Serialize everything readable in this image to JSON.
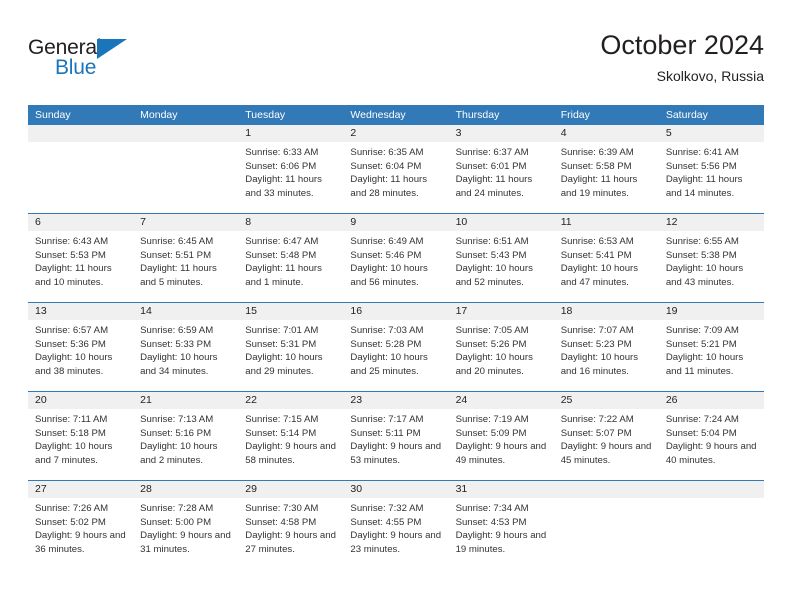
{
  "logo": {
    "word_top": "General",
    "word_bottom": "Blue",
    "accent_color": "#1b75bb"
  },
  "header": {
    "title": "October 2024",
    "subtitle": "Skolkovo, Russia"
  },
  "theme": {
    "header_bg": "#3179b7",
    "datebar_bg": "#f0f0f0",
    "divider": "#3179b7",
    "text": "#222222"
  },
  "weekdays": [
    "Sunday",
    "Monday",
    "Tuesday",
    "Wednesday",
    "Thursday",
    "Friday",
    "Saturday"
  ],
  "weeks": [
    [
      {
        "day": "",
        "sunrise": "",
        "sunset": "",
        "daylight": ""
      },
      {
        "day": "",
        "sunrise": "",
        "sunset": "",
        "daylight": ""
      },
      {
        "day": "1",
        "sunrise": "Sunrise: 6:33 AM",
        "sunset": "Sunset: 6:06 PM",
        "daylight": "Daylight: 11 hours and 33 minutes."
      },
      {
        "day": "2",
        "sunrise": "Sunrise: 6:35 AM",
        "sunset": "Sunset: 6:04 PM",
        "daylight": "Daylight: 11 hours and 28 minutes."
      },
      {
        "day": "3",
        "sunrise": "Sunrise: 6:37 AM",
        "sunset": "Sunset: 6:01 PM",
        "daylight": "Daylight: 11 hours and 24 minutes."
      },
      {
        "day": "4",
        "sunrise": "Sunrise: 6:39 AM",
        "sunset": "Sunset: 5:58 PM",
        "daylight": "Daylight: 11 hours and 19 minutes."
      },
      {
        "day": "5",
        "sunrise": "Sunrise: 6:41 AM",
        "sunset": "Sunset: 5:56 PM",
        "daylight": "Daylight: 11 hours and 14 minutes."
      }
    ],
    [
      {
        "day": "6",
        "sunrise": "Sunrise: 6:43 AM",
        "sunset": "Sunset: 5:53 PM",
        "daylight": "Daylight: 11 hours and 10 minutes."
      },
      {
        "day": "7",
        "sunrise": "Sunrise: 6:45 AM",
        "sunset": "Sunset: 5:51 PM",
        "daylight": "Daylight: 11 hours and 5 minutes."
      },
      {
        "day": "8",
        "sunrise": "Sunrise: 6:47 AM",
        "sunset": "Sunset: 5:48 PM",
        "daylight": "Daylight: 11 hours and 1 minute."
      },
      {
        "day": "9",
        "sunrise": "Sunrise: 6:49 AM",
        "sunset": "Sunset: 5:46 PM",
        "daylight": "Daylight: 10 hours and 56 minutes."
      },
      {
        "day": "10",
        "sunrise": "Sunrise: 6:51 AM",
        "sunset": "Sunset: 5:43 PM",
        "daylight": "Daylight: 10 hours and 52 minutes."
      },
      {
        "day": "11",
        "sunrise": "Sunrise: 6:53 AM",
        "sunset": "Sunset: 5:41 PM",
        "daylight": "Daylight: 10 hours and 47 minutes."
      },
      {
        "day": "12",
        "sunrise": "Sunrise: 6:55 AM",
        "sunset": "Sunset: 5:38 PM",
        "daylight": "Daylight: 10 hours and 43 minutes."
      }
    ],
    [
      {
        "day": "13",
        "sunrise": "Sunrise: 6:57 AM",
        "sunset": "Sunset: 5:36 PM",
        "daylight": "Daylight: 10 hours and 38 minutes."
      },
      {
        "day": "14",
        "sunrise": "Sunrise: 6:59 AM",
        "sunset": "Sunset: 5:33 PM",
        "daylight": "Daylight: 10 hours and 34 minutes."
      },
      {
        "day": "15",
        "sunrise": "Sunrise: 7:01 AM",
        "sunset": "Sunset: 5:31 PM",
        "daylight": "Daylight: 10 hours and 29 minutes."
      },
      {
        "day": "16",
        "sunrise": "Sunrise: 7:03 AM",
        "sunset": "Sunset: 5:28 PM",
        "daylight": "Daylight: 10 hours and 25 minutes."
      },
      {
        "day": "17",
        "sunrise": "Sunrise: 7:05 AM",
        "sunset": "Sunset: 5:26 PM",
        "daylight": "Daylight: 10 hours and 20 minutes."
      },
      {
        "day": "18",
        "sunrise": "Sunrise: 7:07 AM",
        "sunset": "Sunset: 5:23 PM",
        "daylight": "Daylight: 10 hours and 16 minutes."
      },
      {
        "day": "19",
        "sunrise": "Sunrise: 7:09 AM",
        "sunset": "Sunset: 5:21 PM",
        "daylight": "Daylight: 10 hours and 11 minutes."
      }
    ],
    [
      {
        "day": "20",
        "sunrise": "Sunrise: 7:11 AM",
        "sunset": "Sunset: 5:18 PM",
        "daylight": "Daylight: 10 hours and 7 minutes."
      },
      {
        "day": "21",
        "sunrise": "Sunrise: 7:13 AM",
        "sunset": "Sunset: 5:16 PM",
        "daylight": "Daylight: 10 hours and 2 minutes."
      },
      {
        "day": "22",
        "sunrise": "Sunrise: 7:15 AM",
        "sunset": "Sunset: 5:14 PM",
        "daylight": "Daylight: 9 hours and 58 minutes."
      },
      {
        "day": "23",
        "sunrise": "Sunrise: 7:17 AM",
        "sunset": "Sunset: 5:11 PM",
        "daylight": "Daylight: 9 hours and 53 minutes."
      },
      {
        "day": "24",
        "sunrise": "Sunrise: 7:19 AM",
        "sunset": "Sunset: 5:09 PM",
        "daylight": "Daylight: 9 hours and 49 minutes."
      },
      {
        "day": "25",
        "sunrise": "Sunrise: 7:22 AM",
        "sunset": "Sunset: 5:07 PM",
        "daylight": "Daylight: 9 hours and 45 minutes."
      },
      {
        "day": "26",
        "sunrise": "Sunrise: 7:24 AM",
        "sunset": "Sunset: 5:04 PM",
        "daylight": "Daylight: 9 hours and 40 minutes."
      }
    ],
    [
      {
        "day": "27",
        "sunrise": "Sunrise: 7:26 AM",
        "sunset": "Sunset: 5:02 PM",
        "daylight": "Daylight: 9 hours and 36 minutes."
      },
      {
        "day": "28",
        "sunrise": "Sunrise: 7:28 AM",
        "sunset": "Sunset: 5:00 PM",
        "daylight": "Daylight: 9 hours and 31 minutes."
      },
      {
        "day": "29",
        "sunrise": "Sunrise: 7:30 AM",
        "sunset": "Sunset: 4:58 PM",
        "daylight": "Daylight: 9 hours and 27 minutes."
      },
      {
        "day": "30",
        "sunrise": "Sunrise: 7:32 AM",
        "sunset": "Sunset: 4:55 PM",
        "daylight": "Daylight: 9 hours and 23 minutes."
      },
      {
        "day": "31",
        "sunrise": "Sunrise: 7:34 AM",
        "sunset": "Sunset: 4:53 PM",
        "daylight": "Daylight: 9 hours and 19 minutes."
      },
      {
        "day": "",
        "sunrise": "",
        "sunset": "",
        "daylight": ""
      },
      {
        "day": "",
        "sunrise": "",
        "sunset": "",
        "daylight": ""
      }
    ]
  ]
}
